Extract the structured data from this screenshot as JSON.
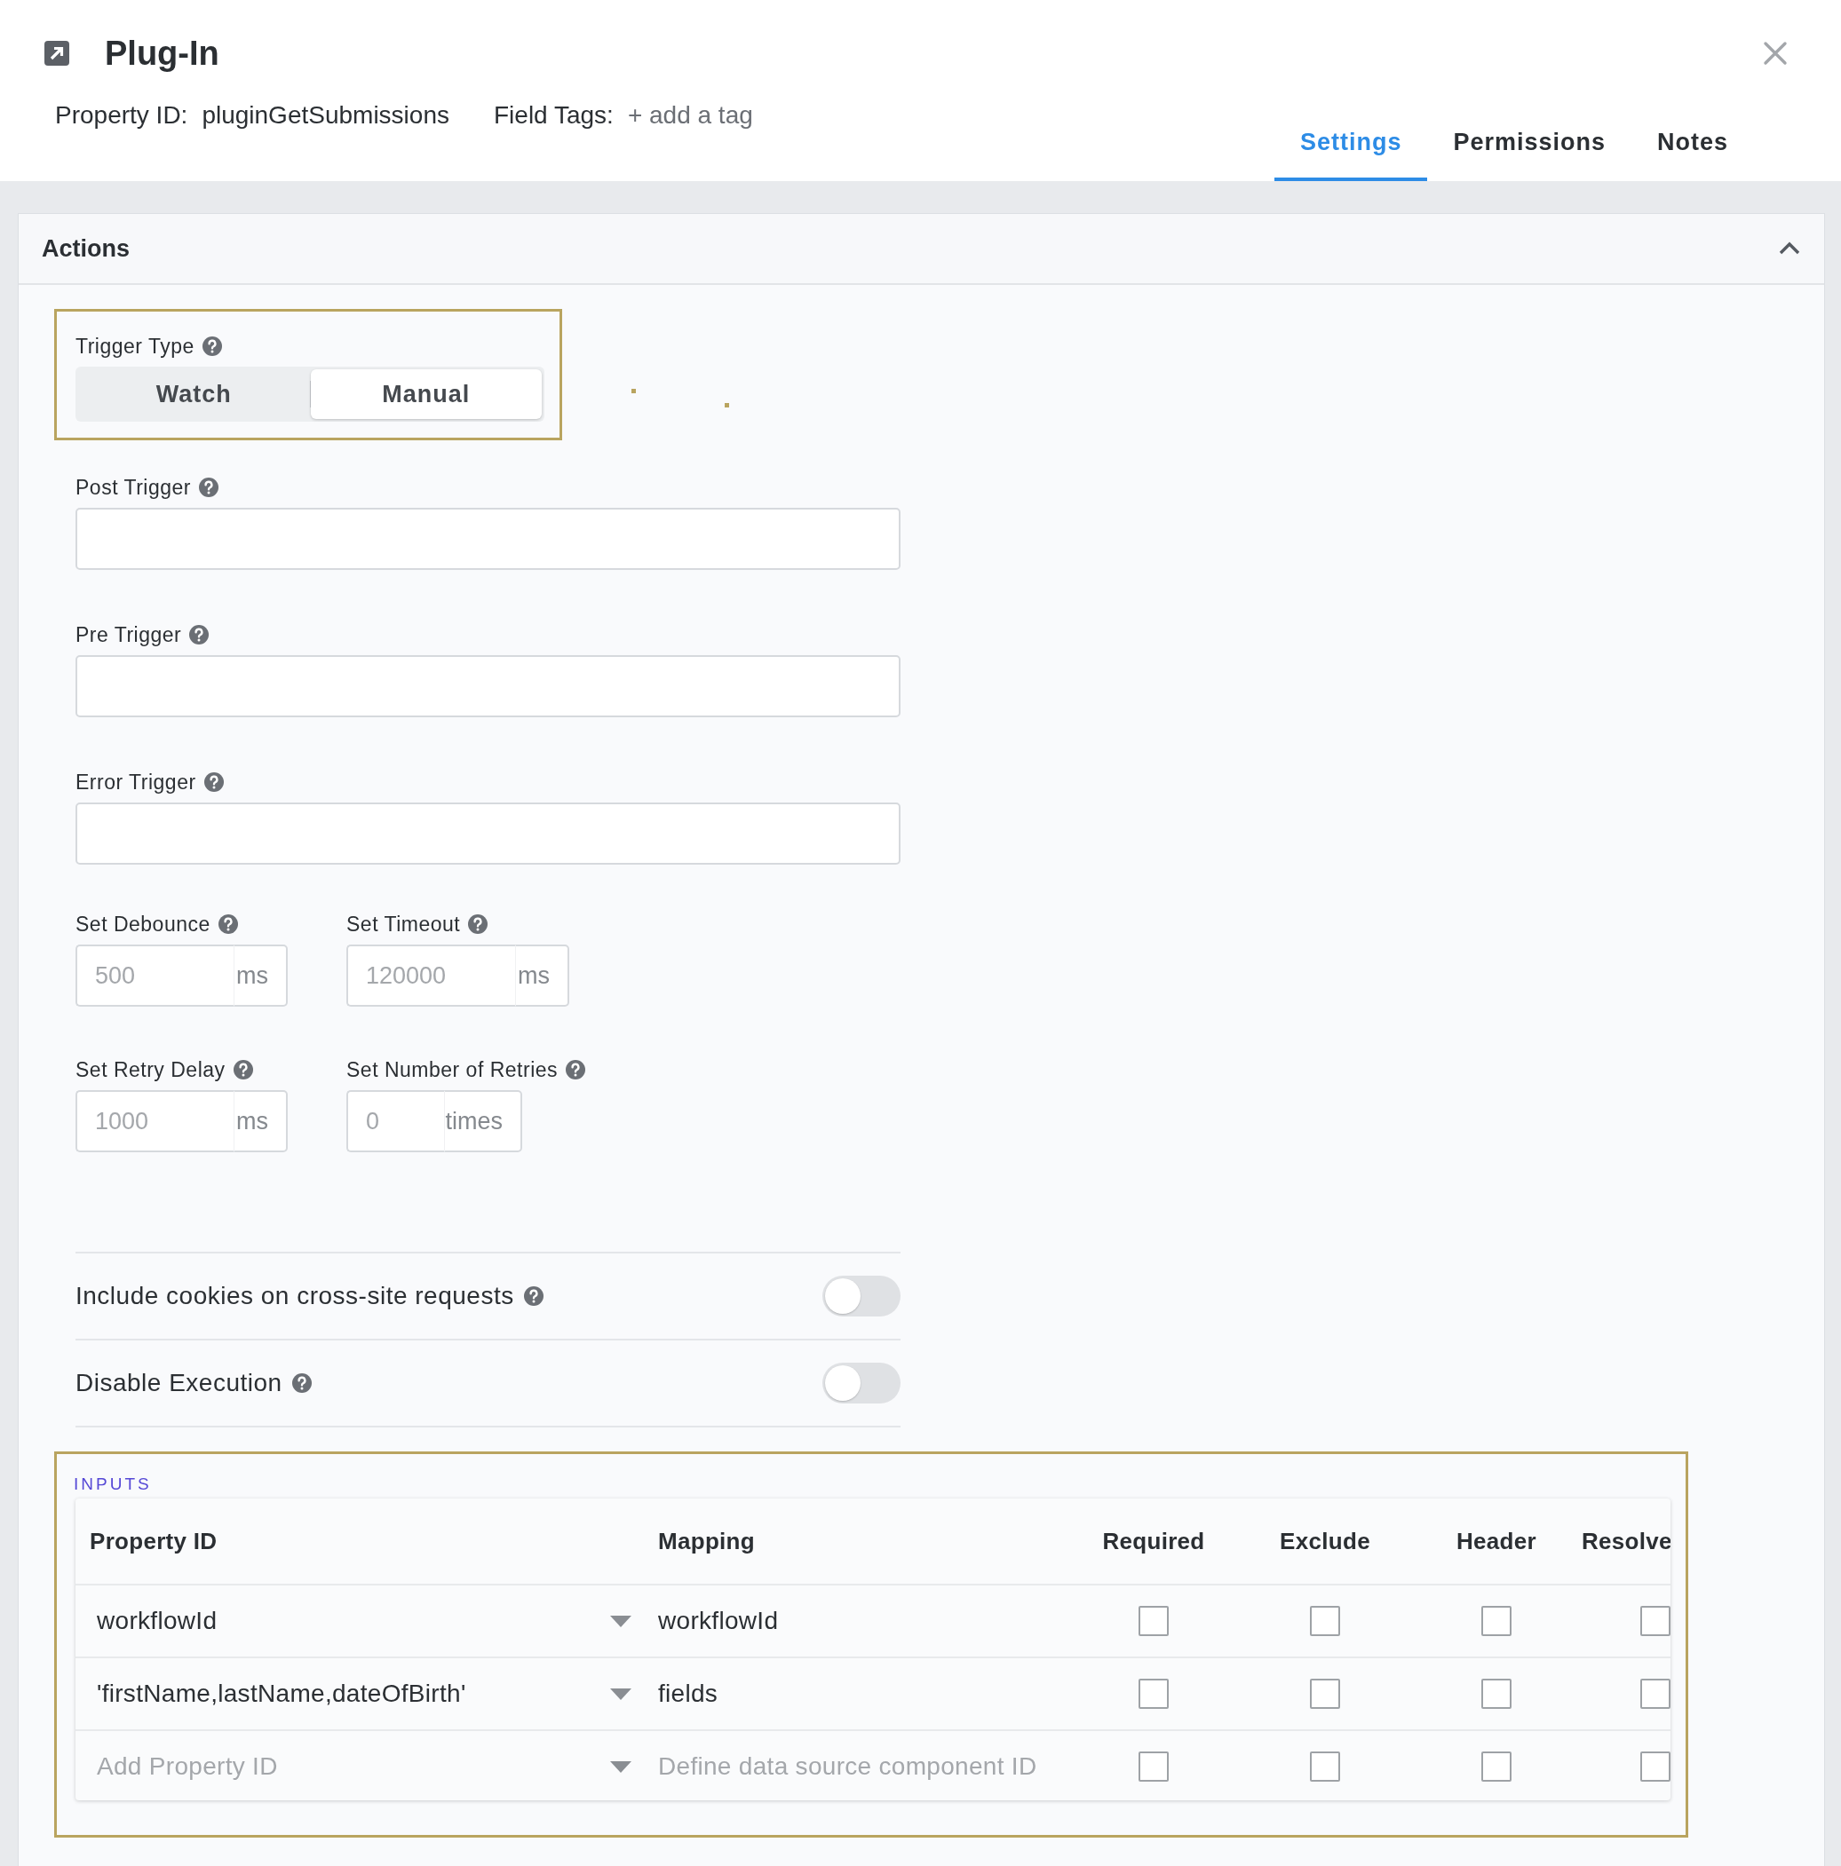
{
  "dialog": {
    "title": "Plug-In",
    "property_id_label": "Property ID:",
    "property_id": "pluginGetSubmissions",
    "field_tags_label": "Field Tags:",
    "add_tag": "+ add a tag"
  },
  "tabs": [
    {
      "label": "Settings",
      "selected": true
    },
    {
      "label": "Permissions",
      "selected": false
    },
    {
      "label": "Notes",
      "selected": false
    }
  ],
  "section": {
    "title": "Actions",
    "expanded": true
  },
  "trigger_type": {
    "label": "Trigger Type",
    "options": [
      {
        "label": "Watch",
        "selected": false
      },
      {
        "label": "Manual",
        "selected": true
      }
    ]
  },
  "text_fields": [
    {
      "label": "Post Trigger"
    },
    {
      "label": "Pre Trigger"
    },
    {
      "label": "Error Trigger"
    }
  ],
  "number_fields": [
    [
      {
        "label": "Set Debounce",
        "placeholder": "500",
        "unit": "ms"
      },
      {
        "label": "Set Timeout",
        "placeholder": "120000",
        "unit": "ms"
      }
    ],
    [
      {
        "label": "Set Retry Delay",
        "placeholder": "1000",
        "unit": "ms"
      },
      {
        "label": "Set Number of Retries",
        "placeholder": "0",
        "unit": "times"
      }
    ]
  ],
  "toggles": [
    {
      "label": "Include cookies on cross-site requests",
      "on": false
    },
    {
      "label": "Disable Execution",
      "on": false
    }
  ],
  "inputs": {
    "title": "INPUTS",
    "columns": [
      "Property ID",
      "Mapping",
      "Required",
      "Exclude",
      "Header",
      "Resolve"
    ],
    "rows": [
      {
        "kind": "entry",
        "property_id": "workflowId",
        "mapping": "workflowId",
        "required": false,
        "exclude": false,
        "header": false,
        "resolve": false
      },
      {
        "kind": "entry",
        "property_id": "'firstName,lastName,dateOfBirth'",
        "mapping": "fields",
        "required": false,
        "exclude": false,
        "header": false,
        "resolve": false
      },
      {
        "kind": "new",
        "property_placeholder": "Add Property ID",
        "mapping_placeholder": "Define data source component ID",
        "required": false,
        "exclude": false,
        "header": false,
        "resolve": false
      }
    ]
  }
}
